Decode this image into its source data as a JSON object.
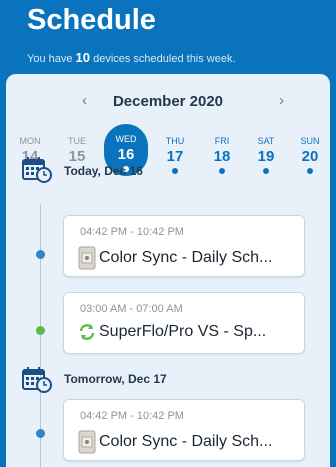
{
  "header": {
    "title": "Schedule",
    "subtitle_prefix": "You have",
    "device_count": "10",
    "subtitle_suffix": "devices scheduled this week."
  },
  "calendar": {
    "month": "December 2020",
    "prev_icon": "chevron-left-icon",
    "next_icon": "chevron-right-icon",
    "days": [
      {
        "name": "MON",
        "num": "14",
        "state": "muted",
        "has_event": false
      },
      {
        "name": "TUE",
        "num": "15",
        "state": "muted",
        "has_event": false
      },
      {
        "name": "WED",
        "num": "16",
        "state": "selected",
        "has_event": true
      },
      {
        "name": "THU",
        "num": "17",
        "state": "normal",
        "has_event": true
      },
      {
        "name": "FRI",
        "num": "18",
        "state": "normal",
        "has_event": true
      },
      {
        "name": "SAT",
        "num": "19",
        "state": "normal",
        "has_event": true
      },
      {
        "name": "SUN",
        "num": "20",
        "state": "normal",
        "has_event": true
      }
    ]
  },
  "sections": [
    {
      "title": "Today, Dec 16",
      "icon": "calendar-clock-icon",
      "events": [
        {
          "time": "04:42 PM - 10:42 PM",
          "name": "Color Sync - Daily Sch...",
          "icon": "color-sync-device-icon",
          "dot_color": "#2b86c9"
        },
        {
          "time": "03:00 AM - 07:00 AM",
          "name": "SuperFlo/Pro VS - Sp...",
          "icon": "pump-sync-icon",
          "dot_color": "#5cb947"
        }
      ]
    },
    {
      "title": "Tomorrow, Dec 17",
      "icon": "calendar-clock-icon",
      "events": [
        {
          "time": "04:42 PM - 10:42 PM",
          "name": "Color Sync - Daily Sch...",
          "icon": "color-sync-device-icon",
          "dot_color": "#2b86c9"
        }
      ]
    }
  ],
  "colors": {
    "brand_blue": "#0a73bd",
    "panel_bg": "#e8f1fa",
    "green": "#5cb947"
  }
}
